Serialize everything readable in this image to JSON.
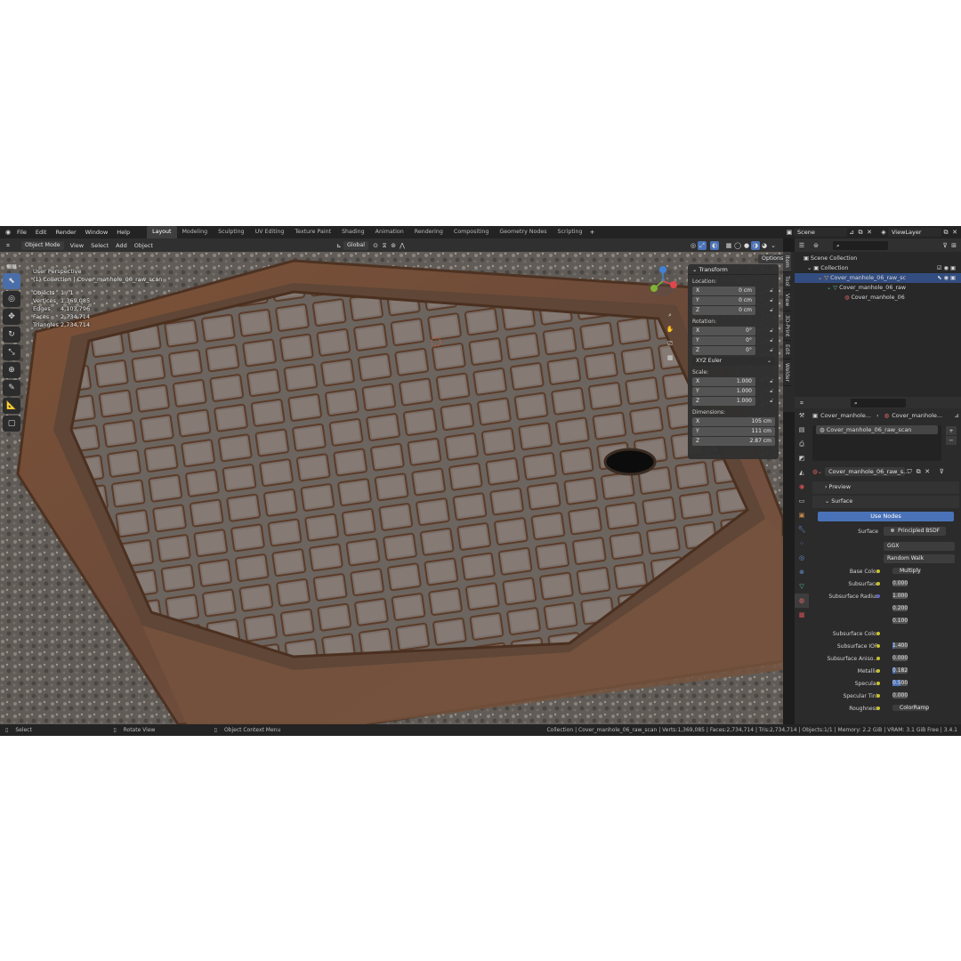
{
  "menu": [
    "File",
    "Edit",
    "Render",
    "Window",
    "Help"
  ],
  "workspaces": [
    "Layout",
    "Modeling",
    "Sculpting",
    "UV Editing",
    "Texture Paint",
    "Shading",
    "Animation",
    "Rendering",
    "Compositing",
    "Geometry Nodes",
    "Scripting"
  ],
  "active_workspace": "Layout",
  "scene": {
    "label": "Scene",
    "viewlayer": "ViewLayer"
  },
  "viewport_header": {
    "mode": "Object Mode",
    "items": [
      "View",
      "Select",
      "Add",
      "Object"
    ],
    "orientation": "Global",
    "options": "Options"
  },
  "overlay": {
    "perspective": "User Perspective",
    "collection": "(1) Collection | Cover_manhole_06_raw_scan",
    "stats": [
      [
        "Objects",
        "1 / 1"
      ],
      [
        "Vertices",
        "1,369,085"
      ],
      [
        "Edges",
        "4,103,796"
      ],
      [
        "Faces",
        "2,734,714"
      ],
      [
        "Triangles",
        "2,734,714"
      ]
    ]
  },
  "side_tabs": [
    "Item",
    "Tool",
    "View",
    "3D-Print",
    "Edit",
    "Welder"
  ],
  "transform": {
    "title": "Transform",
    "location_label": "Location:",
    "location": [
      [
        "X",
        "0 cm"
      ],
      [
        "Y",
        "0 cm"
      ],
      [
        "Z",
        "0 cm"
      ]
    ],
    "rotation_label": "Rotation:",
    "rotation": [
      [
        "X",
        "0°"
      ],
      [
        "Y",
        "0°"
      ],
      [
        "Z",
        "0°"
      ]
    ],
    "rotation_mode": "XYZ Euler",
    "scale_label": "Scale:",
    "scale": [
      [
        "X",
        "1.000"
      ],
      [
        "Y",
        "1.000"
      ],
      [
        "Z",
        "1.000"
      ]
    ],
    "dimensions_label": "Dimensions:",
    "dimensions": [
      [
        "X",
        "105 cm"
      ],
      [
        "Y",
        "111 cm"
      ],
      [
        "Z",
        "2.87 cm"
      ]
    ]
  },
  "outliner": {
    "rows": [
      "Scene Collection",
      "Collection",
      "Cover_manhole_06_raw_sc",
      "Cover_manhole_06_raw",
      "Cover_manhole_06"
    ]
  },
  "properties": {
    "breadcrumb": [
      "Cover_manhole...",
      "Cover_manhole..."
    ],
    "slot": "Cover_manhole_06_raw_scan",
    "material": "Cover_manhole_06_raw_s...",
    "preview": "Preview",
    "surface": "Surface",
    "use_nodes": "Use Nodes",
    "surface_label": "Surface",
    "surface_value": "Principled BSDF",
    "distribution": "GGX",
    "subsurface_method": "Random Walk",
    "rows": [
      {
        "label": "Base Color",
        "value": "Multiply",
        "kind": "link"
      },
      {
        "label": "Subsurface",
        "value": "0.000",
        "fill": 0
      },
      {
        "label": "Subsurface Radius",
        "value": "1.000",
        "fill": 0
      },
      {
        "label": "",
        "value": "0.200",
        "fill": 0
      },
      {
        "label": "",
        "value": "0.100",
        "fill": 0
      },
      {
        "label": "Subsurface Color",
        "value": "",
        "kind": "color"
      },
      {
        "label": "Subsurface IOR",
        "value": "1.400",
        "fill": 0.12
      },
      {
        "label": "Subsurface Aniso...",
        "value": "0.000",
        "fill": 0
      },
      {
        "label": "Metallic",
        "value": "0.182",
        "fill": 0.18
      },
      {
        "label": "Specular",
        "value": "0.500",
        "fill": 0.5
      },
      {
        "label": "Specular Tint",
        "value": "0.000",
        "fill": 0
      },
      {
        "label": "Roughness",
        "value": "ColorRamp",
        "kind": "link"
      }
    ]
  },
  "status": {
    "left": [
      "Select",
      "Rotate View",
      "Object Context Menu"
    ],
    "right": "Collection | Cover_manhole_06_raw_scan | Verts:1,369,085 | Faces:2,734,714 | Tris:2,734,714 | Objects:1/1 | Memory: 2.2 GiB | VRAM: 3.1 GiB Free | 3.4.1"
  },
  "colors": {
    "accent": "#4a72b8",
    "rust": "#7a5238",
    "gravel": "#6e6a65"
  }
}
